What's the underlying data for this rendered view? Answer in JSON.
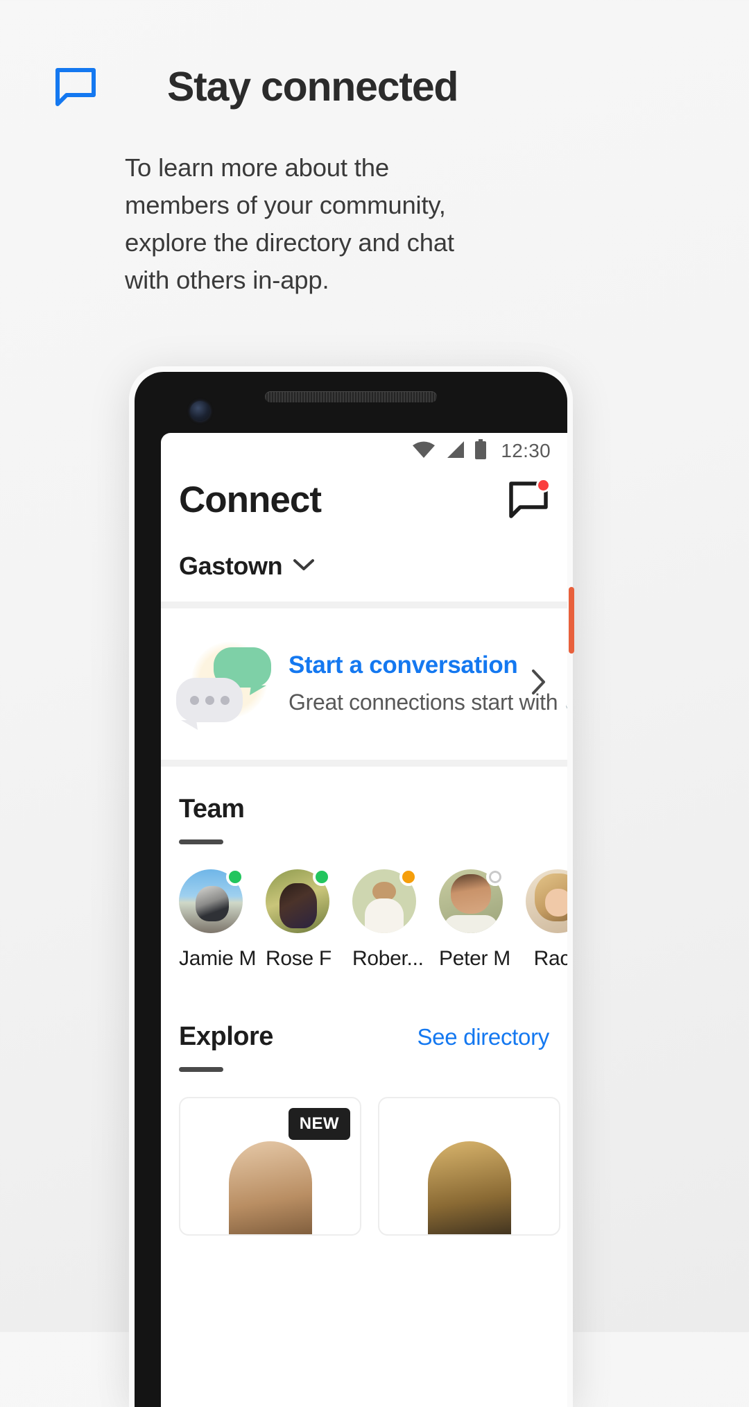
{
  "promo": {
    "icon": "chat-bubble-icon",
    "title": "Stay connected",
    "body": "To learn more about the members of your community, explore the directory and chat with others in-app."
  },
  "phone": {
    "status_bar": {
      "wifi_icon": "wifi-icon",
      "signal_icon": "cellular-signal-icon",
      "battery_icon": "battery-full-icon",
      "time": "12:30"
    },
    "app": {
      "title": "Connect",
      "header_icon": "chat-bubble-icon",
      "header_badge": "notification-dot",
      "community": {
        "name": "Gastown",
        "chevron_icon": "chevron-down-icon"
      },
      "conversation_card": {
        "illustration": "chat-bubbles-illustration",
        "title": "Start a conversation",
        "subtitle": "Great connections start with 👋",
        "chevron_icon": "chevron-right-icon"
      },
      "team": {
        "title": "Team",
        "members": [
          {
            "name": "Jamie M",
            "status": "online",
            "status_color": "#22c55e",
            "photo": "ph-jamie"
          },
          {
            "name": "Rose F",
            "status": "online",
            "status_color": "#22c55e",
            "photo": "ph-rose"
          },
          {
            "name": "Rober...",
            "status": "away",
            "status_color": "#f59e0b",
            "photo": "ph-robert"
          },
          {
            "name": "Peter M",
            "status": "offline",
            "status_color": "#ffffff",
            "photo": "ph-peter"
          },
          {
            "name": "Rach",
            "status": "online",
            "status_color": "#22c55e",
            "photo": "ph-rachel"
          }
        ]
      },
      "explore": {
        "title": "Explore",
        "link": "See directory",
        "cards": [
          {
            "badge": "NEW",
            "photo": "cp-1"
          },
          {
            "badge": "",
            "photo": "cp-2"
          },
          {
            "badge": "",
            "photo": "cp-3"
          }
        ]
      }
    }
  },
  "colors": {
    "accent_blue": "#1478f0",
    "badge_red": "#fa3e3e",
    "online_green": "#22c55e",
    "away_orange": "#f59e0b",
    "text_dark": "#1d1d1d"
  }
}
